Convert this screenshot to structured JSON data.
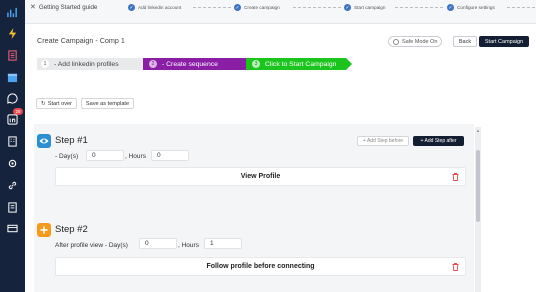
{
  "guide": {
    "title": "Getting Started guide",
    "steps": [
      "Add linkedin account",
      "Create campaign",
      "Start campaign",
      "Configure settings"
    ]
  },
  "header": {
    "title": "Create Campaign - Comp 1",
    "safe_mode": "Safe Mode On",
    "back": "Back",
    "start": "Start Campaign"
  },
  "progress": [
    {
      "num": "1",
      "label": "- Add linkedin profiles"
    },
    {
      "num": "2",
      "label": "- Create sequence"
    },
    {
      "num": "3",
      "label": "Click to Start Campaign"
    }
  ],
  "toolbar": {
    "start_over": "Start over",
    "save_template": "Save as template"
  },
  "steps": [
    {
      "title": "Step #1",
      "add_before": "+ Add Step before",
      "add_after": "+ Add Step after",
      "days_label": "- Day(s)",
      "days_value": "0",
      "hours_label": ", Hours",
      "hours_value": "0",
      "action": "View Profile"
    },
    {
      "title": "Step #2",
      "days_label": "After profile view - Day(s)",
      "days_value": "0",
      "hours_label": ", Hours",
      "hours_value": "1",
      "action": "Follow profile before connecting"
    }
  ],
  "nav": {
    "badge": "28"
  },
  "colors": {
    "nav_bg": "#16233d",
    "primary_dark": "#141e33",
    "sequence_purple": "#8a1fa5",
    "start_green": "#1cc41e",
    "step1_blue": "#2b8fd1",
    "step2_orange": "#f59a1b",
    "delete_red": "#e5484d"
  }
}
